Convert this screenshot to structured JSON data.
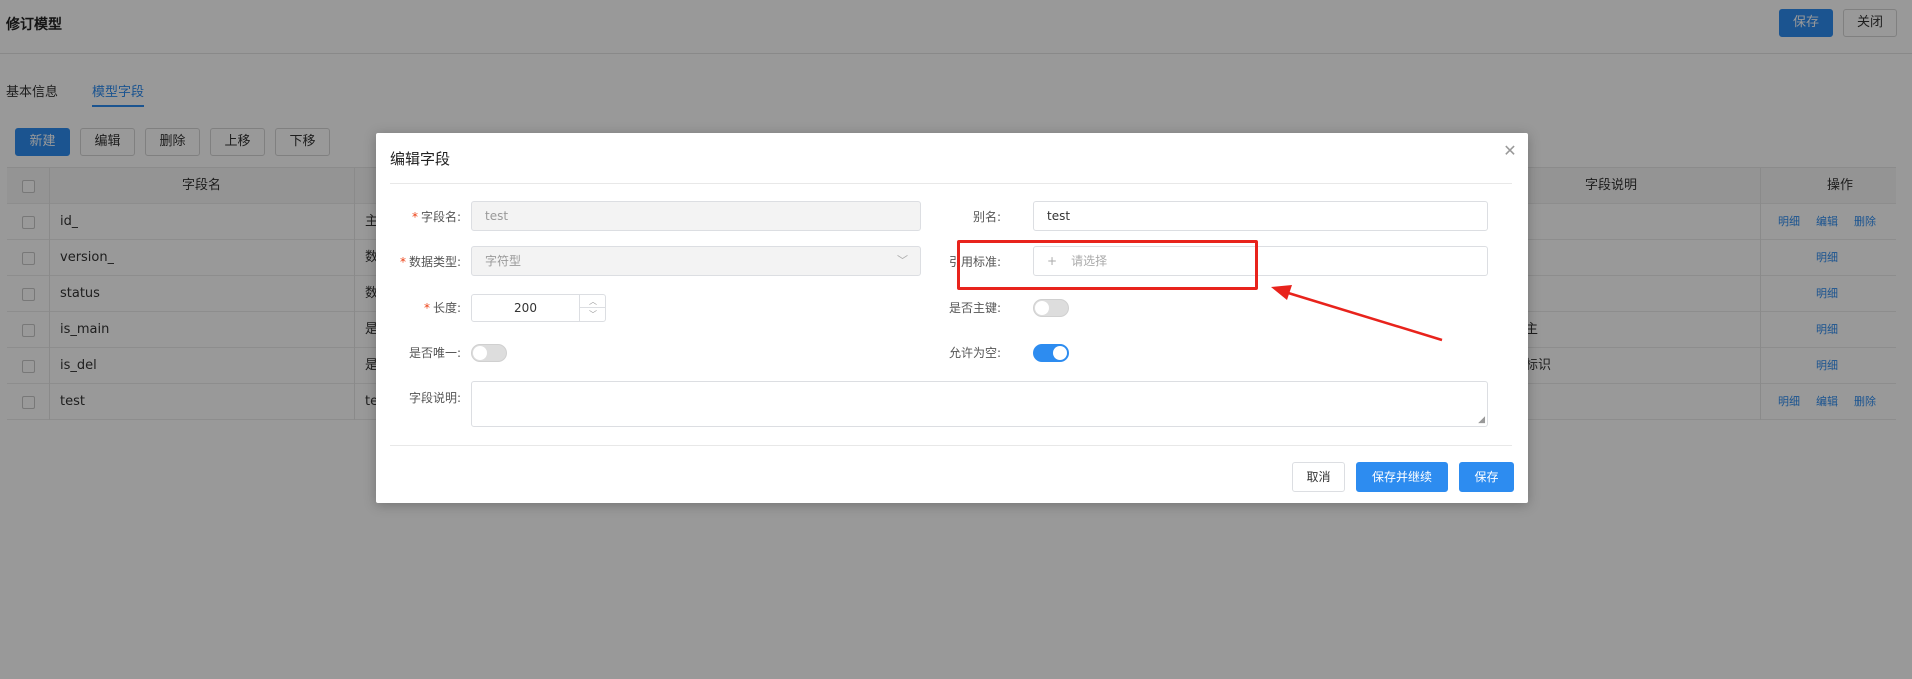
{
  "page": {
    "title": "修订模型",
    "save_label": "保存",
    "close_label": "关闭",
    "tabs": [
      {
        "label": "基本信息"
      },
      {
        "label": "模型字段"
      }
    ],
    "toolbar": {
      "new_label": "新建",
      "edit_label": "编辑",
      "delete_label": "删除",
      "up_label": "上移",
      "down_label": "下移"
    },
    "table": {
      "columns": {
        "field_name": "字段名",
        "field_desc": "字段说明",
        "actions": "操作"
      },
      "rows": [
        {
          "name": "id_",
          "col2": "主",
          "desc": ""
        },
        {
          "name": "version_",
          "col2": "数",
          "desc": ""
        },
        {
          "name": "status",
          "col2": "数",
          "desc": ""
        },
        {
          "name": "is_main",
          "col2": "是",
          "desc": "主"
        },
        {
          "name": "is_del",
          "col2": "是",
          "desc": "标识"
        },
        {
          "name": "test",
          "col2": "te",
          "desc": ""
        }
      ],
      "action_detail": "明细",
      "action_edit": "编辑",
      "action_delete": "删除"
    }
  },
  "dialog": {
    "title": "编辑字段",
    "fields": {
      "field_name_label": "字段名:",
      "field_name_value": "test",
      "alias_label": "别名:",
      "alias_value": "test",
      "data_type_label": "数据类型:",
      "data_type_value": "字符型",
      "ref_standard_label": "引用标准:",
      "ref_standard_placeholder": "请选择",
      "length_label": "长度:",
      "length_value": "200",
      "primary_key_label": "是否主键:",
      "primary_key_on": false,
      "unique_label": "是否唯一:",
      "unique_on": false,
      "nullable_label": "允许为空:",
      "nullable_on": true,
      "desc_label": "字段说明:",
      "desc_value": ""
    },
    "buttons": {
      "cancel": "取消",
      "save_continue": "保存并继续",
      "save": "保存"
    }
  },
  "colors": {
    "primary": "#2d8cf0",
    "highlight": "#e8231c",
    "required": "#ed4014"
  }
}
